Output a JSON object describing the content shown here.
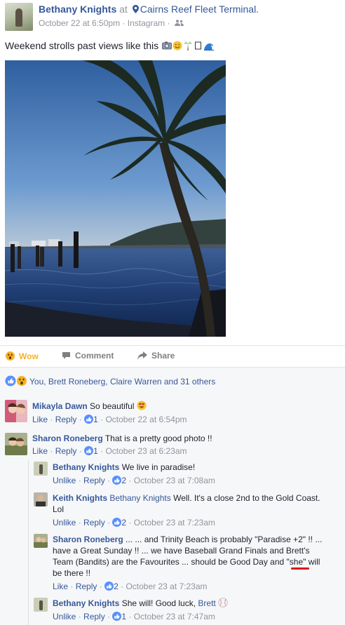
{
  "post": {
    "author": "Bethany Knights",
    "at_word": "at",
    "place": "Cairns Reef Fleet Terminal.",
    "timestamp": "October 22 at 6:50pm",
    "source": "Instagram",
    "text": "Weekend strolls past views like this",
    "privacy_icon": "friends-icon"
  },
  "actions": {
    "wow_label": "Wow",
    "comment_label": "Comment",
    "share_label": "Share"
  },
  "reactions": {
    "summary": "You, Brett Roneberg, Claire Warren and 31 others"
  },
  "comments": [
    {
      "name": "Mikayla Dawn",
      "text": "So beautiful",
      "like_label": "Like",
      "reply_label": "Reply",
      "likes": "1",
      "time": "October 22 at 6:54pm"
    },
    {
      "name": "Sharon Roneberg",
      "text": "That is a pretty good photo !!",
      "like_label": "Like",
      "reply_label": "Reply",
      "likes": "1",
      "time": "October 23 at 6:23am"
    }
  ],
  "replies": [
    {
      "name": "Bethany Knights",
      "text": "We live in paradise!",
      "like_label": "Unlike",
      "reply_label": "Reply",
      "likes": "2",
      "time": "October 23 at 7:08am"
    },
    {
      "name": "Keith Knights",
      "tag": "Bethany Knights",
      "text": "Well. It's a close 2nd to the Gold Coast.",
      "text2": "Lol",
      "like_label": "Unlike",
      "reply_label": "Reply",
      "likes": "2",
      "time": "October 23 at 7:23am"
    },
    {
      "name": "Sharon Roneberg",
      "line1": "... ... and Trinity Beach is probably \"Paradise +2\" !! ...",
      "line2": "have a Great Sunday !! ... we have Baseball Grand Finals and Brett's",
      "line3a": "Team (Bandits) are the Favourites ... should be Good Day and \"",
      "line3b": "she",
      "line3c": "\" will",
      "line4": "be there !!",
      "like_label": "Like",
      "reply_label": "Reply",
      "likes": "2",
      "time": "October 23 at 7:23am"
    },
    {
      "name": "Bethany Knights",
      "text": "She will! Good luck,",
      "tag": "Brett",
      "like_label": "Unlike",
      "reply_label": "Reply",
      "likes": "1",
      "time": "October 23 at 7:47am"
    }
  ],
  "meta_sep": "·",
  "colors": {
    "link": "#365899",
    "wow": "#f7b125",
    "grey": "#90949c",
    "highlight": "#e0131b"
  }
}
